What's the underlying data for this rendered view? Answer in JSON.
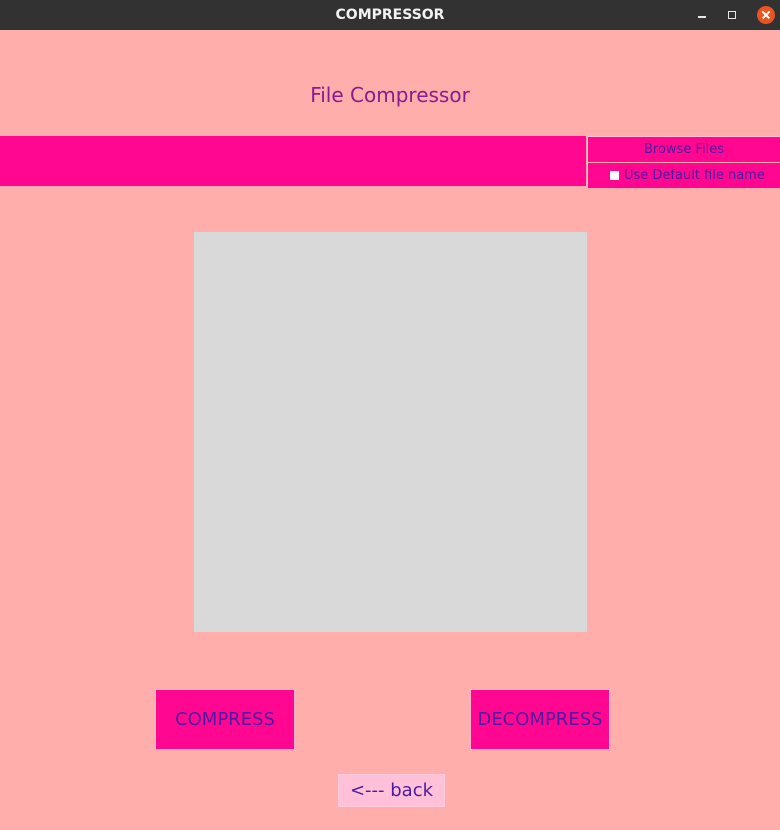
{
  "window": {
    "title": "COMPRESSOR",
    "controls": {
      "minimize_icon": "minimize-icon",
      "maximize_icon": "maximize-icon",
      "close_icon": "close-icon"
    }
  },
  "app": {
    "heading": "File Compressor",
    "file_path": {
      "value": "",
      "color": "#ff0791"
    },
    "browse_label": "Browse Files",
    "default_name": {
      "label": "Use Default file name",
      "checked": false
    },
    "actions": {
      "compress_label": "COMPRESS",
      "decompress_label": "DECOMPRESS",
      "back_label": "<--- back"
    }
  },
  "colors": {
    "background": "#ffaeab",
    "accent": "#ff0791",
    "text": "#4b1aa3",
    "heading": "#8b1a8b",
    "preview": "#d9d9d9",
    "close_button": "#e95420"
  }
}
